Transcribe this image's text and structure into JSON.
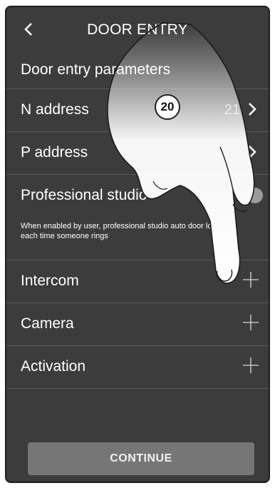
{
  "header": {
    "title": "DOOR ENTRY",
    "back_icon": "chevron-left-icon"
  },
  "section": {
    "title": "Door entry parameters"
  },
  "rows": [
    {
      "label": "N address",
      "value": "21"
    },
    {
      "label": "P address",
      "value": ""
    },
    {
      "label": "Professional studio"
    },
    {
      "label": "Intercom"
    },
    {
      "label": "Camera"
    },
    {
      "label": "Activation"
    }
  ],
  "professional_studio": {
    "description": "When enabled by user, professional studio auto door lock each time someone rings"
  },
  "step_badge": "20",
  "footer": {
    "continue_label": "CONTINUE"
  },
  "colors": {
    "background": "#3c3c3c",
    "button": "#767676",
    "text": "#ffffff"
  }
}
